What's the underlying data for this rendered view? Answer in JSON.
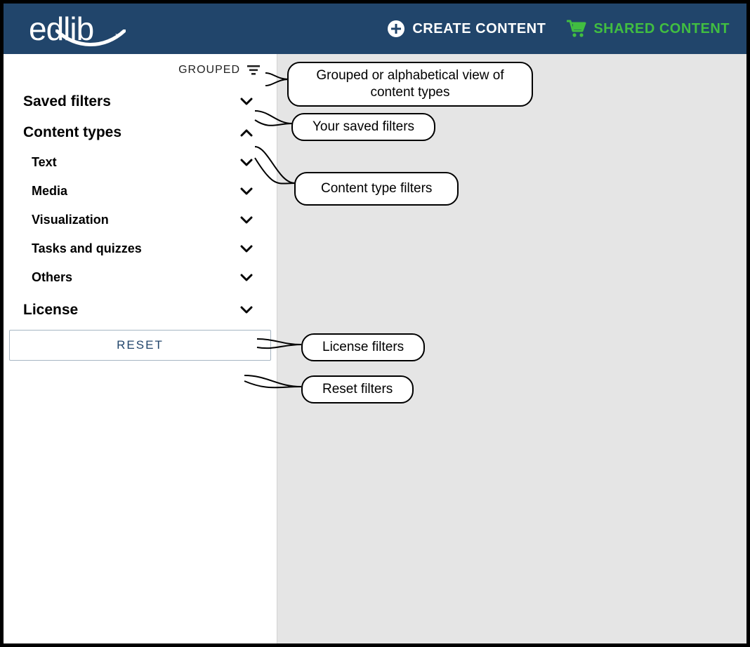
{
  "header": {
    "logo_text": "edlib",
    "create_label": "CREATE CONTENT",
    "shared_label": "SHARED CONTENT"
  },
  "sidebar": {
    "grouped_label": "GROUPED",
    "sections": {
      "saved_filters": "Saved filters",
      "content_types": "Content types",
      "license": "License"
    },
    "content_type_items": [
      "Text",
      "Media",
      "Visualization",
      "Tasks and quizzes",
      "Others"
    ],
    "reset_label": "RESET"
  },
  "callouts": {
    "grouped": "Grouped or alphabetical view of content types",
    "saved_filters": "Your saved filters",
    "content_types": "Content type filters",
    "license": "License filters",
    "reset": "Reset filters"
  }
}
